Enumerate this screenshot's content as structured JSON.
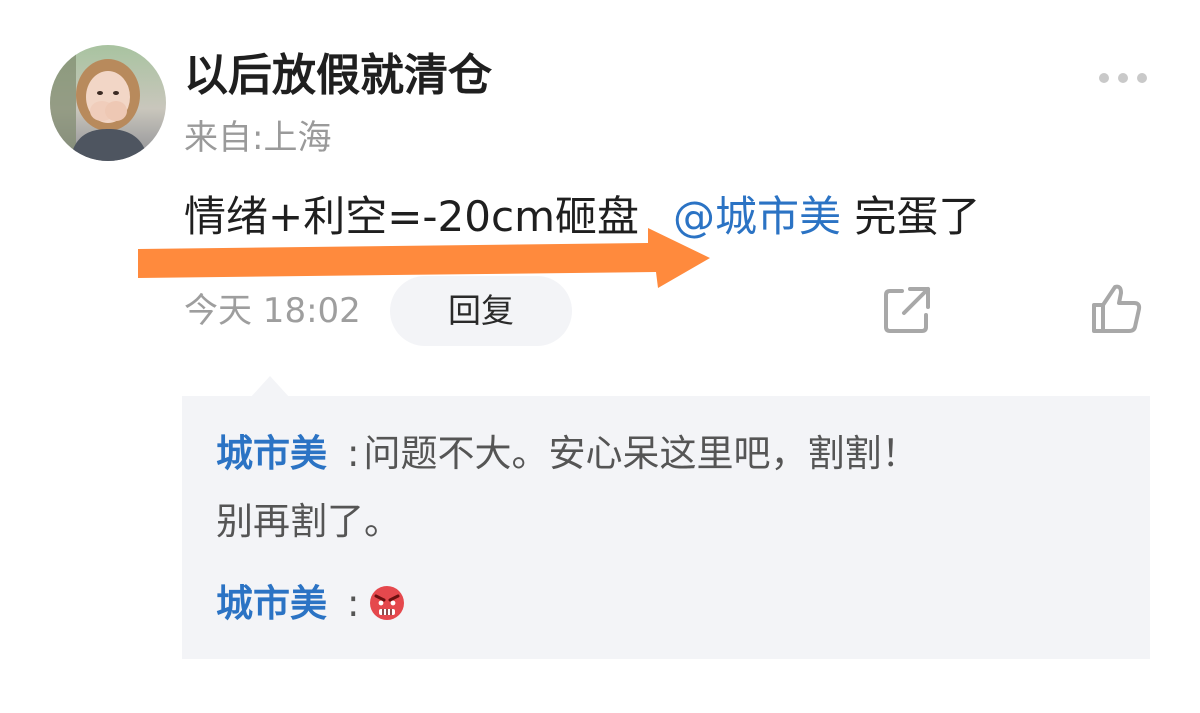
{
  "comment": {
    "username": "以后放假就清仓",
    "location": "来自:上海",
    "text": "情绪+利空=-20cm砸盘",
    "mention": "@城市美",
    "text_after": "完蛋了",
    "timestamp": "今天 18:02",
    "reply_label": "回复",
    "avatar_icon": "user-photo",
    "more_icon": "more-dots-icon",
    "share_icon": "share-icon",
    "like_icon": "thumbs-up-icon"
  },
  "replies": [
    {
      "user": "城市美",
      "separator": ":",
      "text_line1": "问题不大。安心呆这里吧，割割！",
      "text_line2": "别再割了。"
    },
    {
      "user": "城市美",
      "separator": ":",
      "emoji": "angry-face-emoji"
    }
  ],
  "colors": {
    "link": "#2b73c4",
    "arrow": "#ff8a3d",
    "reply_bg": "#f3f4f7",
    "meta_text": "#9e9e9e"
  }
}
